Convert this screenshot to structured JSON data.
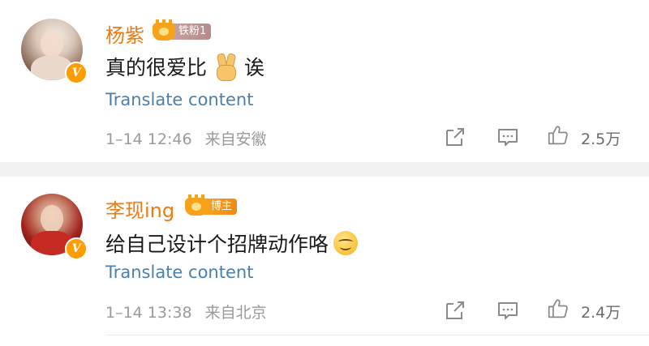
{
  "comments": [
    {
      "username": "杨紫",
      "badge_label": "铁粉1",
      "text_before": "真的很爱比",
      "emoji_1": "victory-hand-emoji",
      "text_after": "诶",
      "translate": "Translate content",
      "time": "1–14 12:46",
      "source": "来自安徽",
      "likes": "2.5万",
      "vip_mark": "V"
    },
    {
      "username": "李现ing",
      "badge_label": "博主",
      "text_before": "给自己设计个招牌动作咯",
      "emoji_1": "smirk-face-emoji",
      "text_after": "",
      "translate": "Translate content",
      "time": "1–14 13:38",
      "source": "来自北京",
      "likes": "2.4万",
      "vip_mark": "V"
    }
  ],
  "colors": {
    "username": "#f07a0c",
    "link": "#4a7fae",
    "meta": "#9b9b9b",
    "separator": "#f2f2f2"
  }
}
